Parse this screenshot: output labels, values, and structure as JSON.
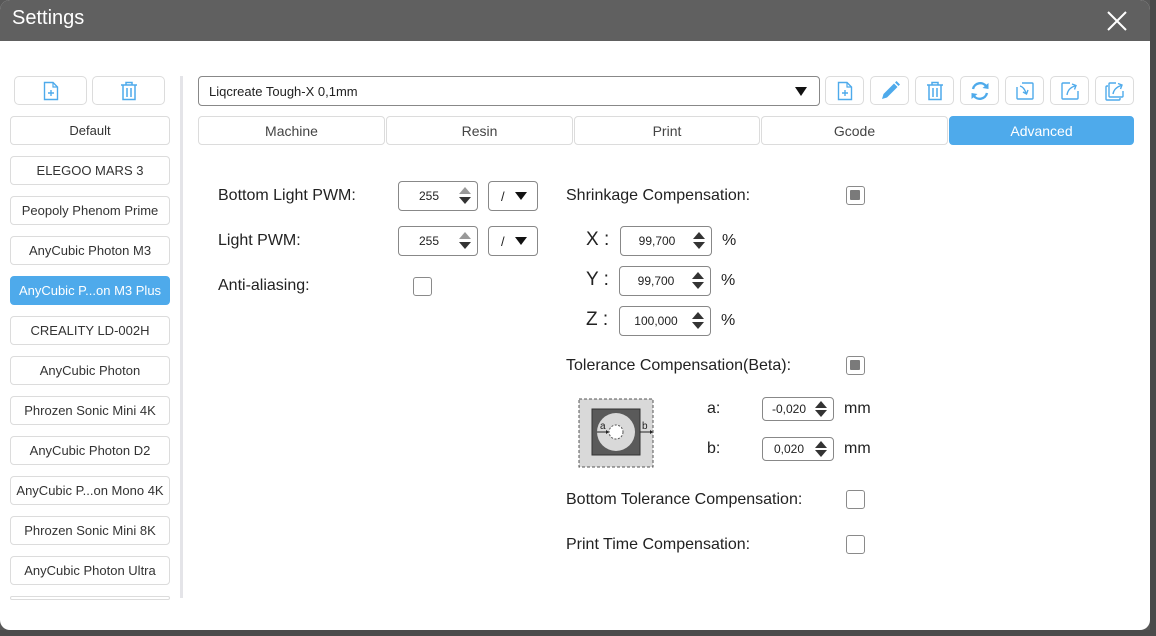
{
  "window": {
    "title": "Settings",
    "close_icon": "close-icon"
  },
  "sidebar": {
    "add_icon": "file-add-icon",
    "delete_icon": "trash-icon",
    "items": [
      {
        "label": "Default",
        "selected": false
      },
      {
        "label": "ELEGOO MARS 3",
        "selected": false
      },
      {
        "label": "Peopoly Phenom Prime",
        "selected": false
      },
      {
        "label": "AnyCubic Photon M3",
        "selected": false
      },
      {
        "label": "AnyCubic P...on M3 Plus",
        "selected": true
      },
      {
        "label": "CREALITY LD-002H",
        "selected": false
      },
      {
        "label": "AnyCubic Photon",
        "selected": false
      },
      {
        "label": "Phrozen Sonic Mini 4K",
        "selected": false
      },
      {
        "label": "AnyCubic Photon D2",
        "selected": false
      },
      {
        "label": "AnyCubic P...on Mono 4K",
        "selected": false
      },
      {
        "label": "Phrozen Sonic Mini 8K",
        "selected": false
      },
      {
        "label": "AnyCubic Photon Ultra",
        "selected": false
      },
      {
        "label": "",
        "selected": false
      }
    ]
  },
  "toolbar": {
    "preset_value": "Liqcreate Tough-X 0,1mm",
    "buttons": [
      "new-preset-icon",
      "edit-icon",
      "delete-icon",
      "refresh-icon",
      "import-icon",
      "export-icon",
      "export-all-icon"
    ]
  },
  "tabs": [
    {
      "label": "Machine",
      "active": false
    },
    {
      "label": "Resin",
      "active": false
    },
    {
      "label": "Print",
      "active": false
    },
    {
      "label": "Gcode",
      "active": false
    },
    {
      "label": "Advanced",
      "active": true
    }
  ],
  "advanced": {
    "bottom_light_pwm": {
      "label": "Bottom Light PWM:",
      "value": "255",
      "option": "/"
    },
    "light_pwm": {
      "label": "Light PWM:",
      "value": "255",
      "option": "/"
    },
    "anti_aliasing": {
      "label": "Anti-aliasing:",
      "checked": false
    },
    "shrinkage": {
      "label": "Shrinkage Compensation:",
      "checked": true,
      "x": {
        "label": "X :",
        "value": "99,700",
        "unit": "%"
      },
      "y": {
        "label": "Y :",
        "value": "99,700",
        "unit": "%"
      },
      "z": {
        "label": "Z :",
        "value": "100,000",
        "unit": "%"
      }
    },
    "tolerance": {
      "label": "Tolerance Compensation(Beta):",
      "checked": true,
      "diagram_a": "a",
      "diagram_b": "b",
      "a": {
        "label": "a:",
        "value": "-0,020",
        "unit": "mm"
      },
      "b": {
        "label": "b:",
        "value": "0,020",
        "unit": "mm"
      }
    },
    "bottom_tolerance": {
      "label": "Bottom Tolerance Compensation:",
      "checked": false
    },
    "print_time": {
      "label": "Print Time Compensation:",
      "checked": false
    }
  },
  "colors": {
    "accent": "#4eaaeb",
    "titlebar": "#606060",
    "icon": "#4eaaeb"
  }
}
